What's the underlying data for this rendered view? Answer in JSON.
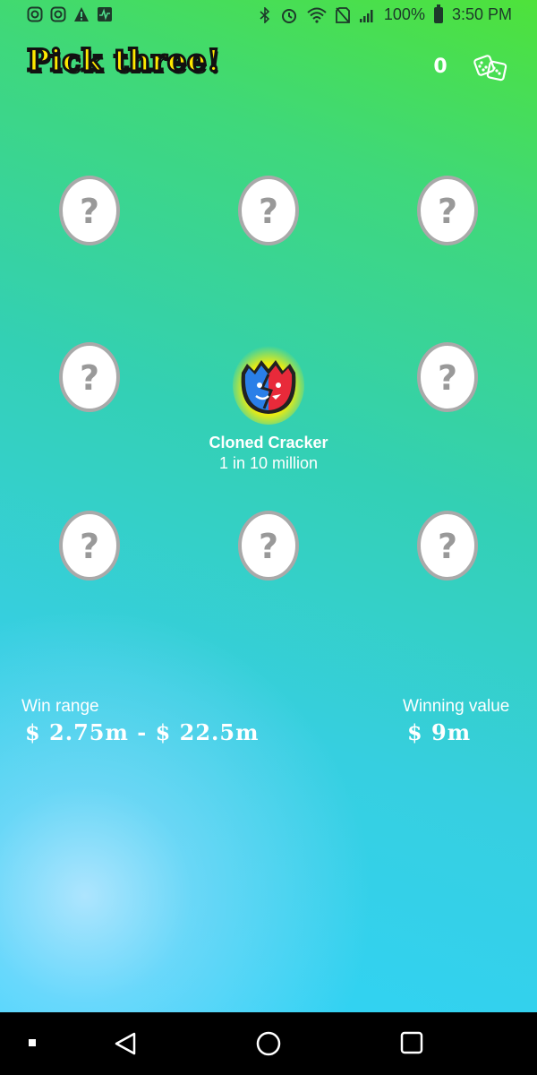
{
  "status": {
    "battery": "100%",
    "time": "3:50 PM"
  },
  "header": {
    "title": "Pick three!",
    "score": "0",
    "dice_icon": "dice-icon"
  },
  "grid": {
    "eggs": [
      {
        "id": "egg-1",
        "icon": "mystery-egg-icon"
      },
      {
        "id": "egg-2",
        "icon": "mystery-egg-icon"
      },
      {
        "id": "egg-3",
        "icon": "mystery-egg-icon"
      },
      {
        "id": "egg-4",
        "icon": "mystery-egg-icon"
      },
      {
        "id": "egg-6",
        "icon": "mystery-egg-icon"
      },
      {
        "id": "egg-7",
        "icon": "mystery-egg-icon"
      },
      {
        "id": "egg-8",
        "icon": "mystery-egg-icon"
      },
      {
        "id": "egg-9",
        "icon": "mystery-egg-icon"
      }
    ],
    "featured": {
      "name": "Cloned Cracker",
      "odds": "1 in 10 million",
      "icon": "cloned-cracker-egg-icon"
    }
  },
  "stats": {
    "win_range_label": "Win range",
    "win_range_value": "$ 2.75m - $ 22.5m",
    "winning_value_label": "Winning value",
    "winning_value": "$ 9m"
  },
  "colors": {
    "title_yellow": "#ffe800",
    "egg_white": "#ffffff",
    "egg_border": "#a9a9a9",
    "featured_glow": "#ffee00",
    "featured_blue": "#2a7fe8",
    "featured_red": "#e82a3a"
  }
}
